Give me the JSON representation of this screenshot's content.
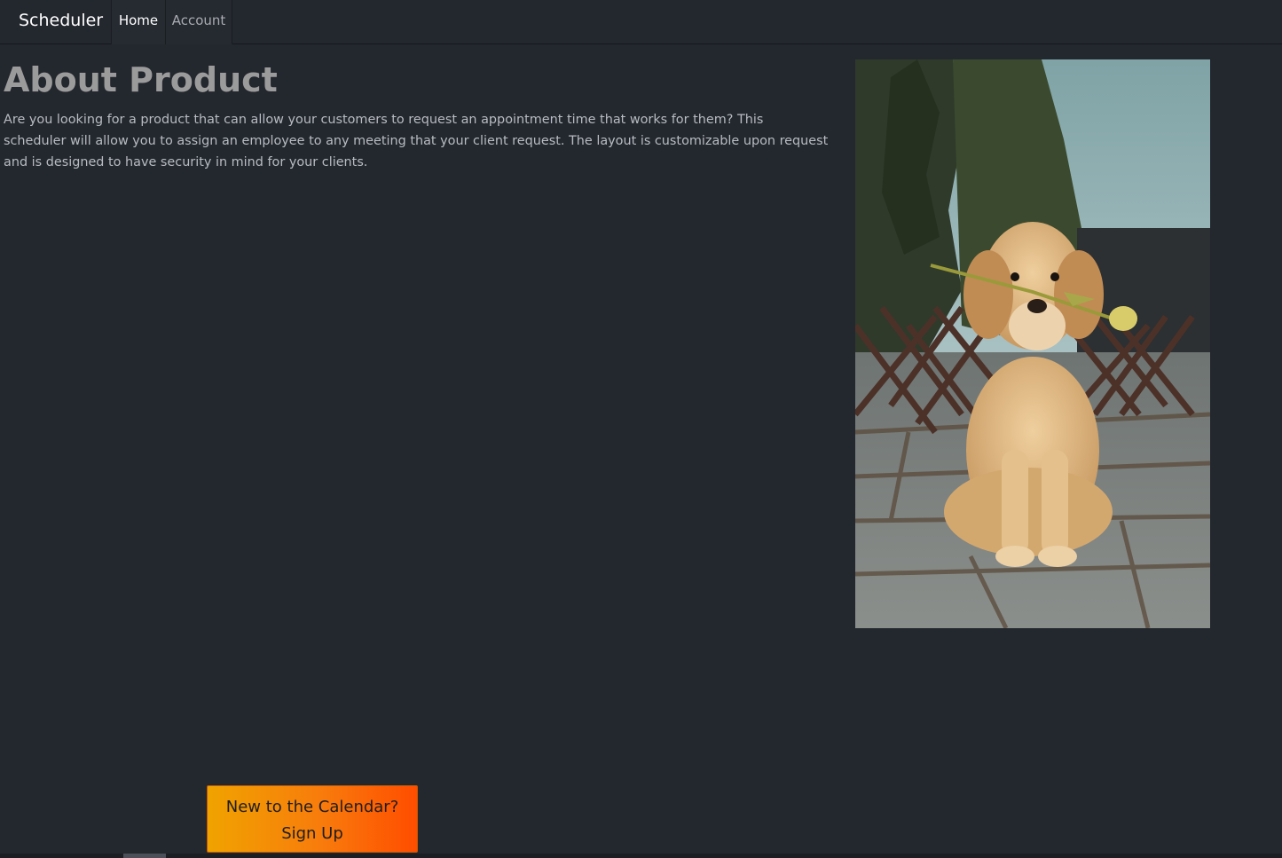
{
  "navbar": {
    "brand": "Scheduler",
    "items": [
      {
        "label": "Home",
        "active": true
      },
      {
        "label": "Account",
        "active": false
      }
    ]
  },
  "main": {
    "title": "About Product",
    "description": "Are you looking for a product that can allow your customers to request an appointment time that works for them? This scheduler will allow you to assign an employee to any meeting that your client request. The layout is customizable upon request and is designed to have security in mind for your clients.",
    "image_subject": "golden-retriever-puppy-with-tulip"
  },
  "cta": {
    "line1": "New to the Calendar?",
    "line2": "Sign Up"
  },
  "colors": {
    "background": "#23272e",
    "heading": "#9b9b9b",
    "cta_start": "#f0a300",
    "cta_end": "#ff4d00"
  }
}
